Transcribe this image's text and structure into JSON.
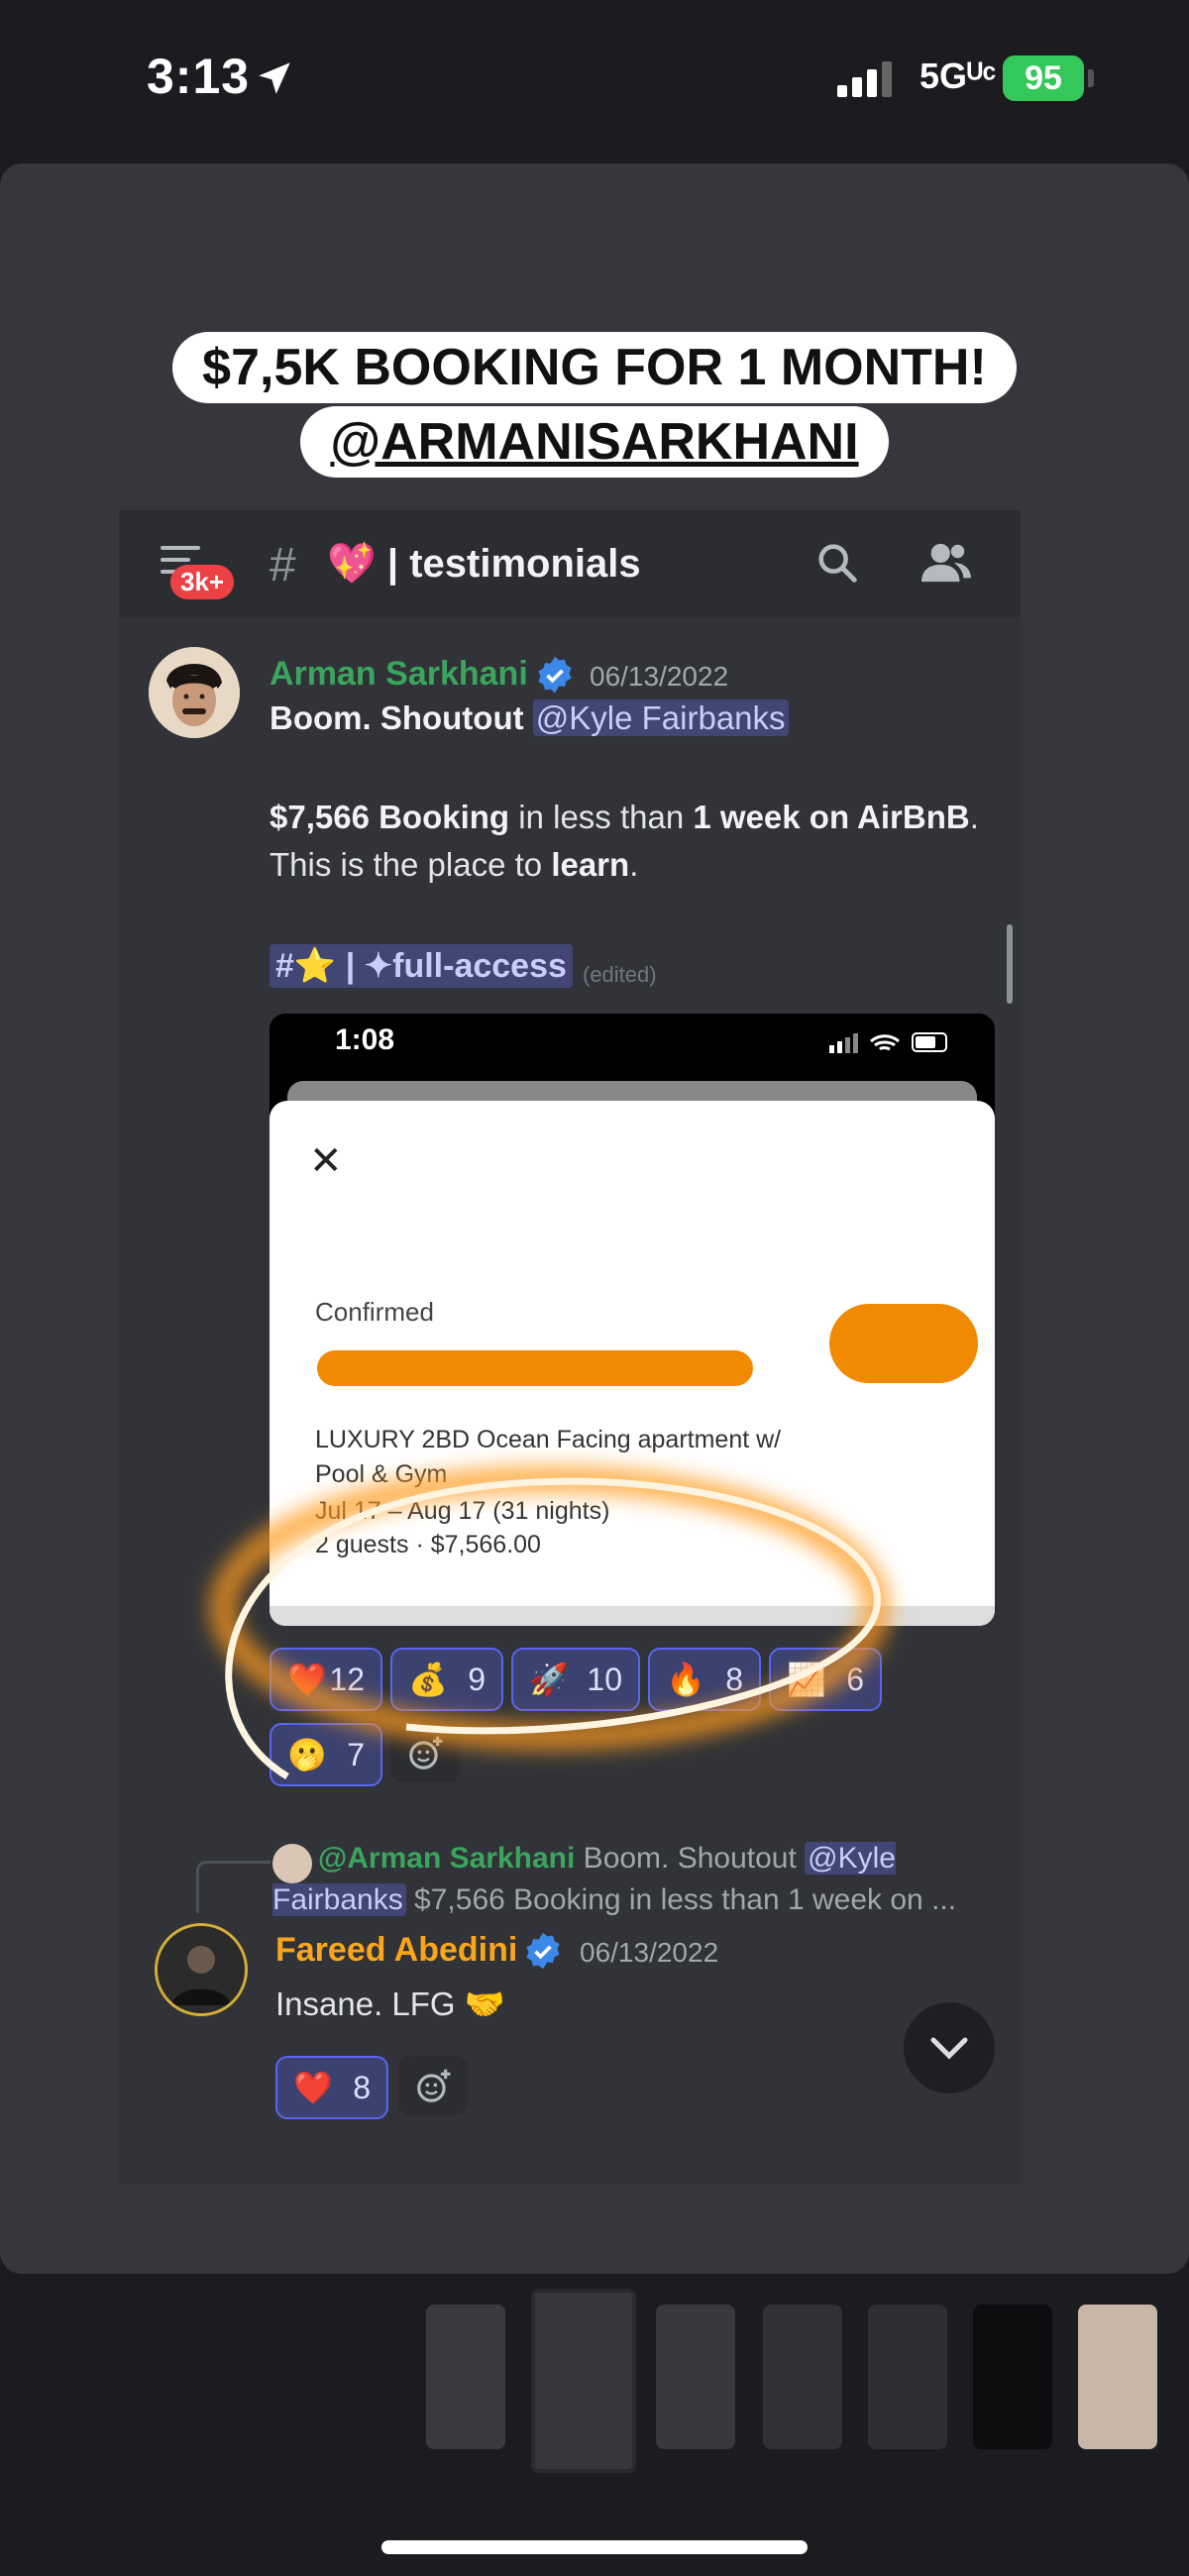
{
  "status_bar": {
    "time": "3:13",
    "network": "5Gᵁᶜ",
    "battery": "95"
  },
  "caption": {
    "line1": "$7,5K BOOKING FOR 1 MONTH!",
    "line2": "@ARMANISARKHANI"
  },
  "header": {
    "badge": "3k+",
    "channel_name": "💖 | testimonials"
  },
  "message1": {
    "author": "Arman Sarkhani",
    "date": "06/13/2022",
    "line1_prefix": "Boom. Shoutout ",
    "mention": "@Kyle Fairbanks",
    "amount": "$7,566 Booking",
    "mid": " in less than ",
    "period": "1 week on AirBnB",
    "end": ".",
    "line3_prefix": "This is the place to ",
    "line3_bold": "learn",
    "line3_end": ".",
    "channel_link": "#⭐ | ✦full-access",
    "edited": "(edited)"
  },
  "screenshot": {
    "time": "1:08",
    "close": "✕",
    "status": "Confirmed",
    "listing": "LUXURY 2BD Ocean Facing apartment w/ Pool & Gym",
    "dates": "Jul 17 – Aug 17 (31 nights)",
    "guests_price": "2 guests · $7,566.00"
  },
  "reactions": [
    {
      "emoji": "❤️",
      "count": "12"
    },
    {
      "emoji": "💰",
      "count": "9"
    },
    {
      "emoji": "🚀",
      "count": "10"
    },
    {
      "emoji": "🔥",
      "count": "8"
    },
    {
      "emoji": "📈",
      "count": "6"
    },
    {
      "emoji": "🫢",
      "count": "7"
    }
  ],
  "reply": {
    "author": "@Arman Sarkhani",
    "text": " Boom. Shoutout ",
    "mention": "@Kyle Fairbanks",
    "rest": " $7,566 Booking in less than 1 week on ..."
  },
  "message2": {
    "author": "Fareed Abedini",
    "date": "06/13/2022",
    "text": "Insane. LFG 🤝",
    "reaction": {
      "emoji": "❤️",
      "count": "8"
    }
  },
  "colors": {
    "accent": "#5865f2",
    "author1": "#3ba55d",
    "author2": "#faa61a",
    "highlight": "#f08a00"
  }
}
